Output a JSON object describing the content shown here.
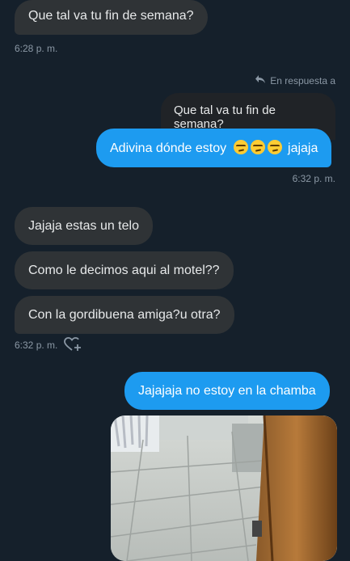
{
  "messages": {
    "m1_text": "Que tal va tu fin de semana?",
    "m1_time": "6:28 p. m.",
    "reply_label": "En respuesta a",
    "quoted_text": "Que tal va tu fin de semana?",
    "m2_text": "Adivina dónde estoy",
    "m2_suffix": "jajaja",
    "m2_time": "6:32 p. m.",
    "m3_text": "Jajaja estas un telo",
    "m4_text": "Como le decimos aqui al motel??",
    "m5_text": "Con la gordibuena amiga?u otra?",
    "m5_time": "6:32 p. m.",
    "m6_text": "Jajajaja no estoy en la chamba"
  },
  "icons": {
    "reply": "reply-arrow-icon",
    "react": "heart-plus-icon",
    "emoji": "smirking-face-emoji"
  },
  "colors": {
    "background": "#15202b",
    "incoming_bubble": "#2f3336",
    "outgoing_bubble": "#1d9bf0",
    "quoted_bubble": "#202327",
    "meta_text": "#8b98a5"
  }
}
